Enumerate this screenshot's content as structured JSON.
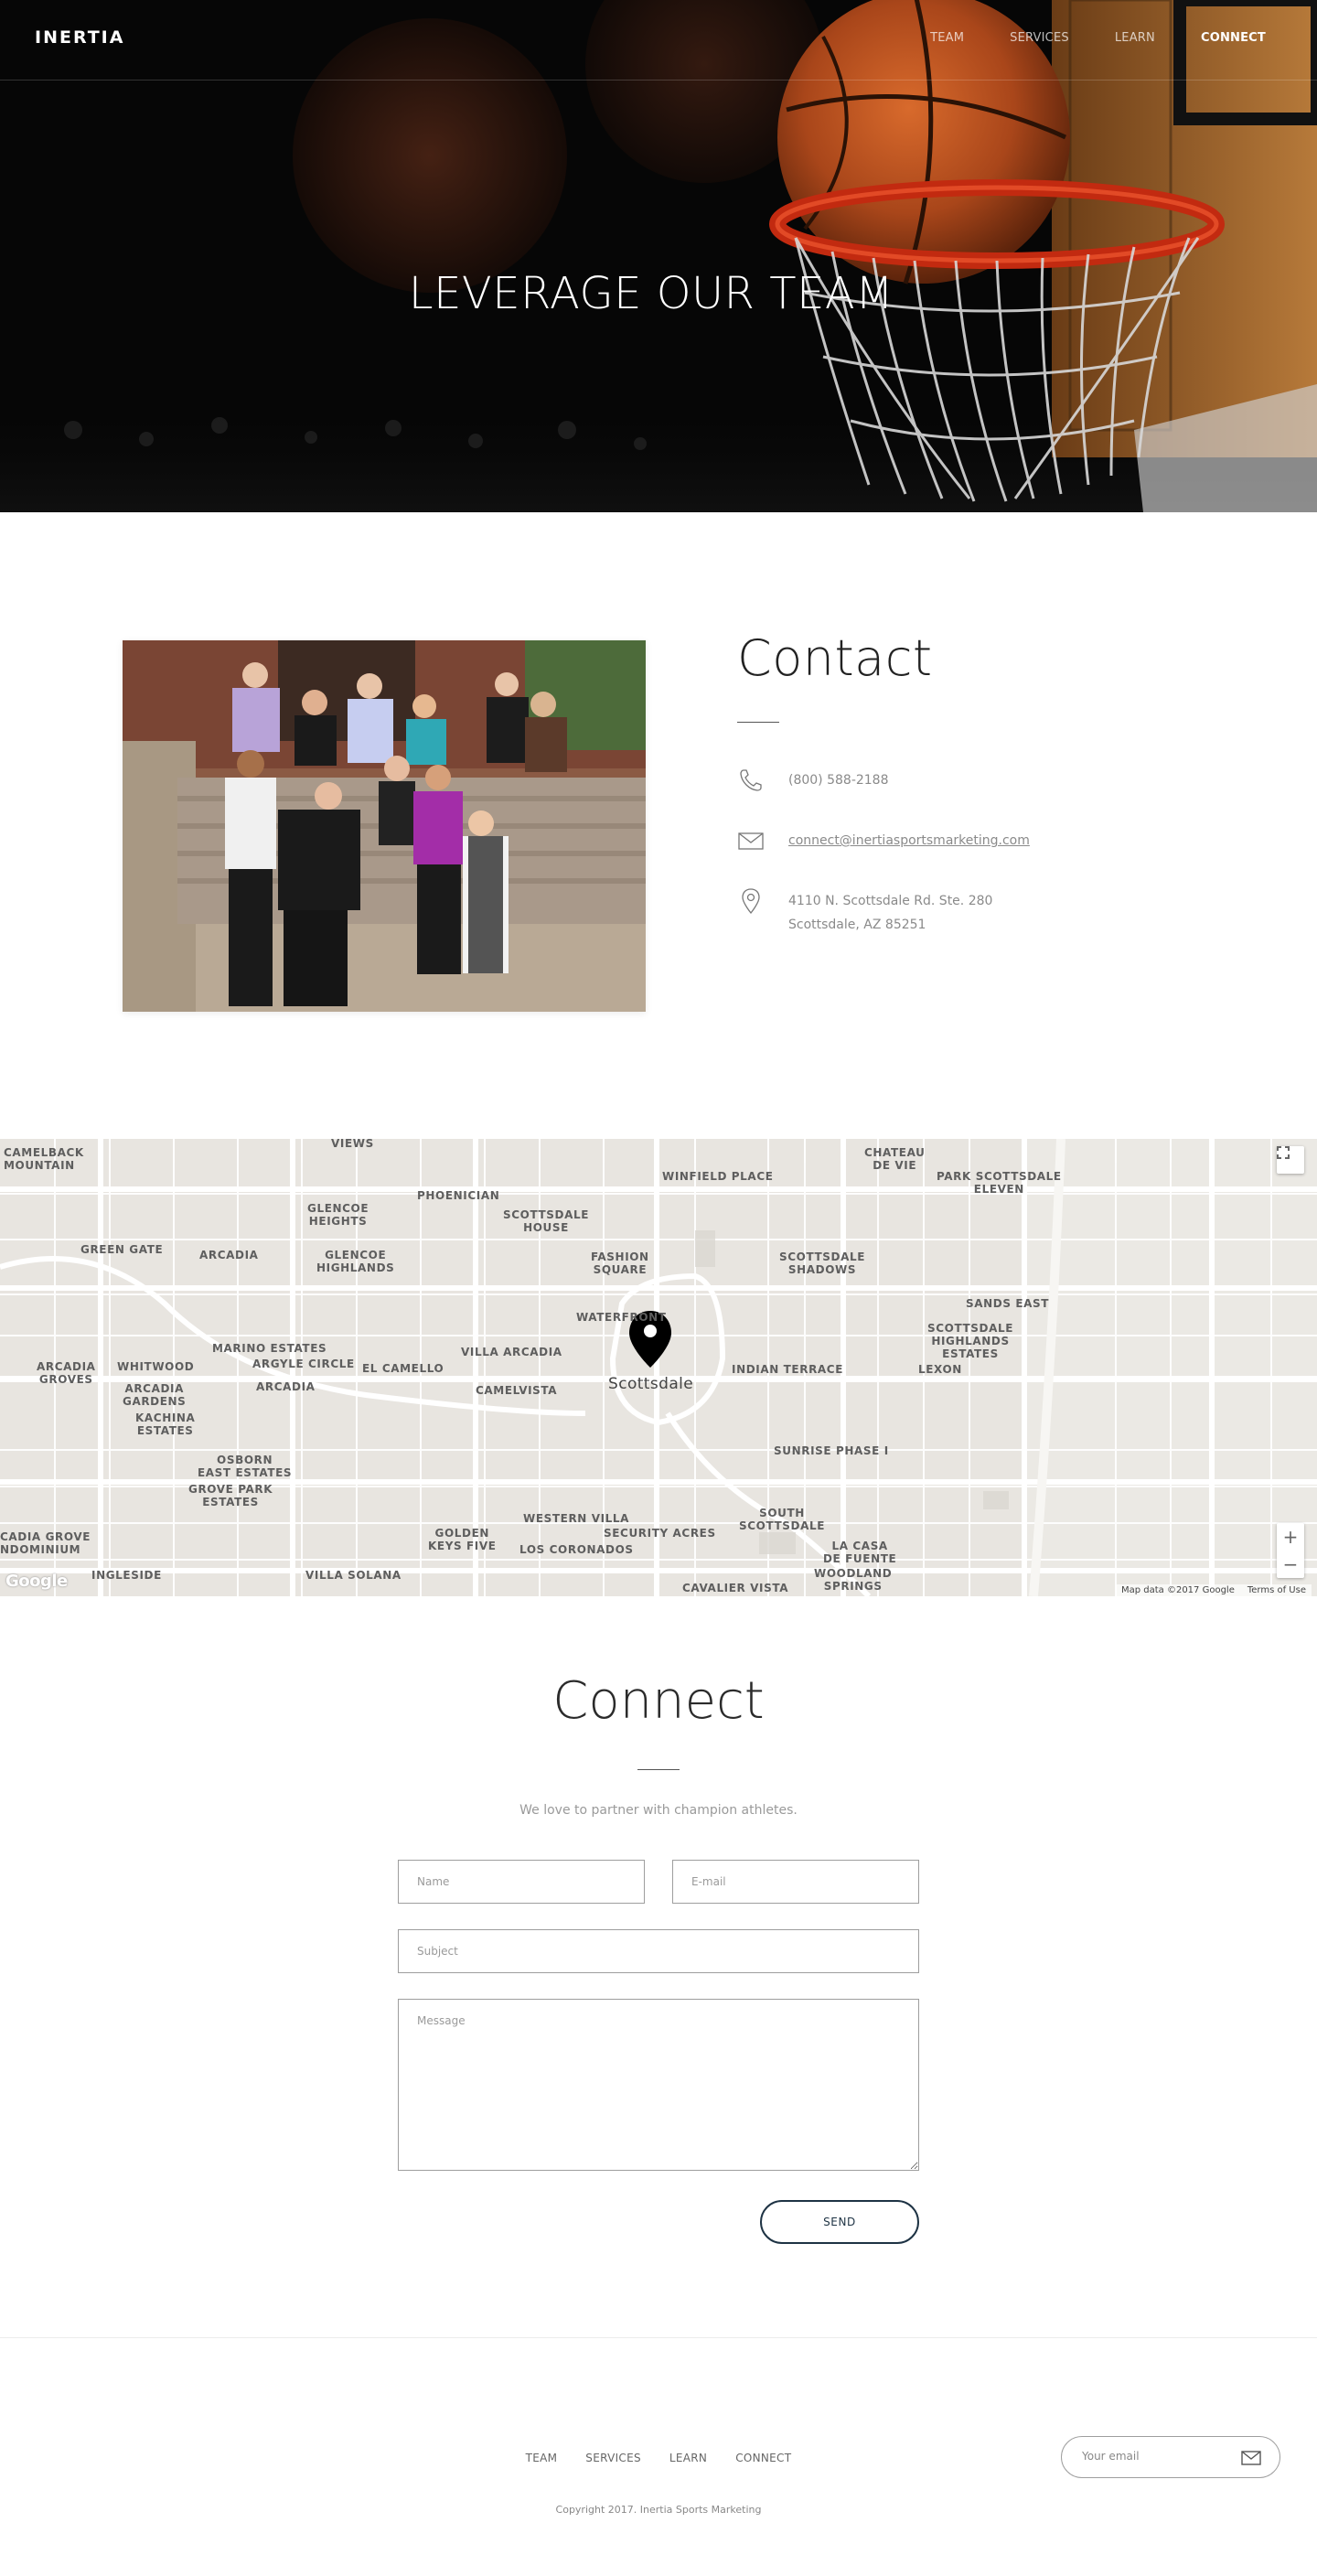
{
  "nav": {
    "logo": "INERTIA",
    "items": [
      {
        "label": "TEAM",
        "active": false
      },
      {
        "label": "SERVICES",
        "active": false
      },
      {
        "label": "LEARN",
        "active": false
      },
      {
        "label": "CONNECT",
        "active": true
      }
    ]
  },
  "hero": {
    "title": "LEVERAGE OUR TEAM"
  },
  "contact": {
    "title": "Contact",
    "phone": "(800) 588-2188",
    "email": "connect@inertiasportsmarketing.com",
    "address_line1": "4110 N. Scottsdale Rd. Ste. 280",
    "address_line2": "Scottsdale, AZ 85251"
  },
  "map": {
    "labels": {
      "camelback_mountain": "CAMELBACK\nMOUNTAIN",
      "views": "VIEWS",
      "phoenician": "PHOENICIAN",
      "winfield_place": "WINFIELD PLACE",
      "chateau_de_vie": "CHATEAU\nDE VIE",
      "park_scottsdale_eleven": "PARK SCOTTSDALE\nELEVEN",
      "glencoe_heights": "GLENCOE\nHEIGHTS",
      "scottsdale_house": "SCOTTSDALE\nHOUSE",
      "green_gate": "GREEN GATE",
      "arcadia_1": "ARCADIA",
      "glencoe_highlands": "GLENCOE\nHIGHLANDS",
      "fashion_square": "FASHION\nSQUARE",
      "scottsdale_shadows": "SCOTTSDALE\nSHADOWS",
      "sands_east": "SANDS EAST",
      "waterfront": "WATERFRONT",
      "scottsdale_highlands_estates": "SCOTTSDALE\nHIGHLANDS\nESTATES",
      "marino_estates": "MARINO ESTATES",
      "argyle_circle": "ARGYLE CIRCLE",
      "villa_arcadia": "VILLA ARCADIA",
      "arcadia_groves": "ARCADIA\nGROVES",
      "whitwood": "WHITWOOD",
      "el_camello": "EL CAMELLO",
      "indian_terrace": "INDIAN TERRACE",
      "lexon": "LEXON",
      "arcadia_gardens": "ARCADIA\nGARDENS",
      "arcadia_2": "ARCADIA",
      "camelvista": "CAMELVISTA",
      "scottsdale": "Scottsdale",
      "kachina_estates": "KACHINA\nESTATES",
      "sunrise_phase_i": "SUNRISE PHASE I",
      "osborn_east_estates": "OSBORN\nEAST ESTATES",
      "grove_park_estates": "GROVE PARK\nESTATES",
      "western_villa": "WESTERN VILLA",
      "south_scottsdale": "SOUTH\nSCOTTSDALE",
      "security_acres": "SECURITY ACRES",
      "arcadia_grove_condominium": "CADIA GROVE\nNDOMINIUM",
      "golden_keys_five": "GOLDEN\nKEYS FIVE",
      "los_coronados": "LOS CORONADOS",
      "la_casa_de_fuente": "LA CASA\nDE FUENTE",
      "ingleside": "INGLESIDE",
      "villa_solana": "VILLA SOLANA",
      "cavalier_vista": "CAVALIER VISTA",
      "woodland_springs": "WOODLAND\nSPRINGS"
    },
    "zoom_in": "+",
    "zoom_out": "−",
    "attribution": "Map data ©2017 Google",
    "terms": "Terms of Use",
    "google_logo": "Google"
  },
  "connect": {
    "title": "Connect",
    "subtitle": "We love to partner with champion athletes.",
    "name_placeholder": "Name",
    "email_placeholder": "E-mail",
    "subject_placeholder": "Subject",
    "message_placeholder": "Message",
    "send_label": "SEND"
  },
  "footer": {
    "links": [
      "TEAM",
      "SERVICES",
      "LEARN",
      "CONNECT"
    ],
    "copyright": "Copyright 2017. Inertia Sports Marketing",
    "subscribe_placeholder": "Your email"
  },
  "colors": {
    "accent": "#1e3344",
    "text_muted": "#8a8a8a",
    "map_bg": "#e8e5e0"
  }
}
